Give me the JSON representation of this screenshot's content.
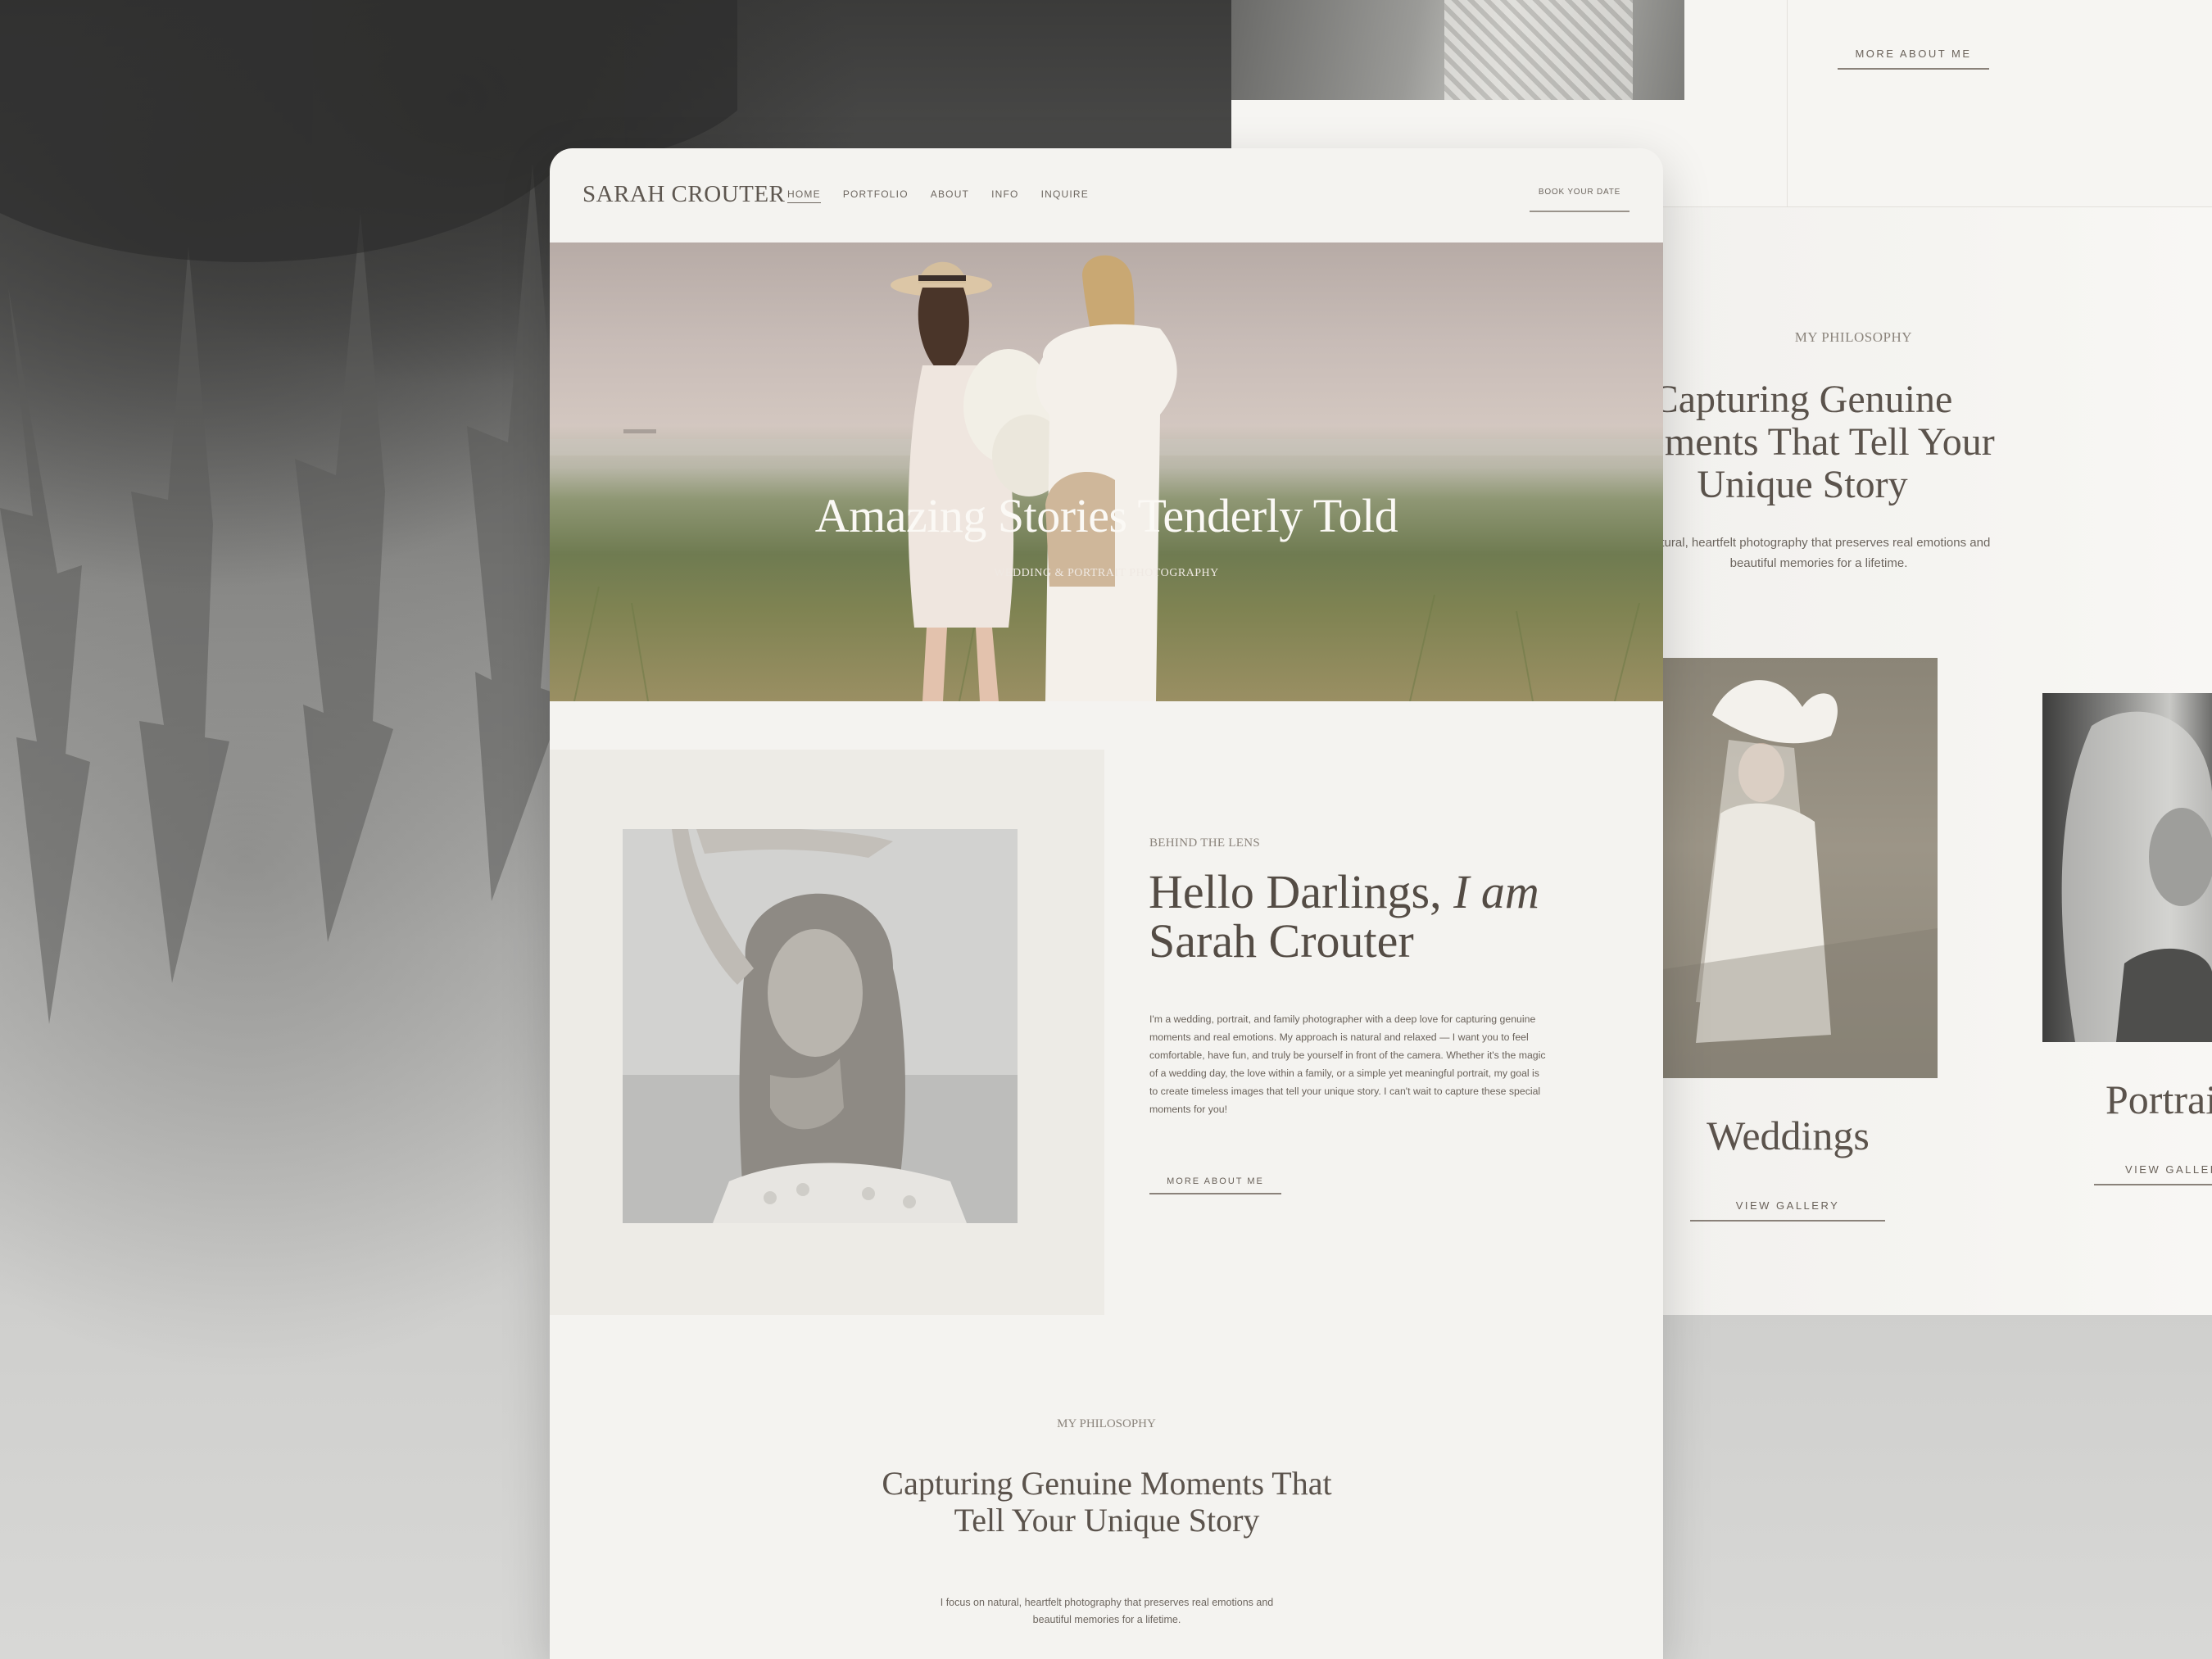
{
  "colors": {
    "page_background": "#f4f3f0",
    "text_dark": "#544c45",
    "text_muted": "#8b847c",
    "about_panel": "#edebe6"
  },
  "site": {
    "logo": "SARAH CROUTER",
    "nav": {
      "items": [
        {
          "label": "HOME",
          "active": true
        },
        {
          "label": "PORTFOLIO",
          "active": false
        },
        {
          "label": "ABOUT",
          "active": false
        },
        {
          "label": "INFO",
          "active": false
        },
        {
          "label": "INQUIRE",
          "active": false
        }
      ],
      "cta": "BOOK YOUR DATE"
    },
    "hero": {
      "title": "Amazing Stories Tenderly Told",
      "subtitle": "WEDDING & PORTRAIT PHOTOGRAPHY"
    },
    "about": {
      "eyebrow": "BEHIND THE LENS",
      "heading_regular": "Hello Darlings,",
      "heading_italic": "I am",
      "heading_line2": "Sarah Crouter",
      "body": "I'm a wedding, portrait, and family photographer with a deep love for capturing genuine moments and real emotions. My approach is natural and relaxed — I want you to feel comfortable, have fun, and truly be yourself in front of the camera. Whether it's the magic of a wedding day, the love within a family, or a simple yet meaningful portrait, my goal is to create timeless images that tell your unique story. I can't wait to capture these special moments for you!",
      "cta": "MORE ABOUT ME"
    },
    "philosophy": {
      "eyebrow": "MY PHILOSOPHY",
      "heading": "Capturing Genuine Moments That Tell Your Unique Story",
      "body": "I focus on natural, heartfelt photography that preserves real emotions and beautiful memories for a lifetime."
    }
  },
  "back_mockup": {
    "top_link": "MORE ABOUT ME",
    "eyebrow": "MY PHILOSOPHY",
    "heading": "Capturing Genuine Moments That Tell Your Unique Story",
    "body": "natural, heartfelt photography that preserves real emotions and beautiful memories for a lifetime.",
    "galleries": [
      {
        "title": "Weddings",
        "link": "VIEW GALLERY"
      },
      {
        "title": "Portrait",
        "link": "VIEW GALLERY"
      }
    ]
  }
}
